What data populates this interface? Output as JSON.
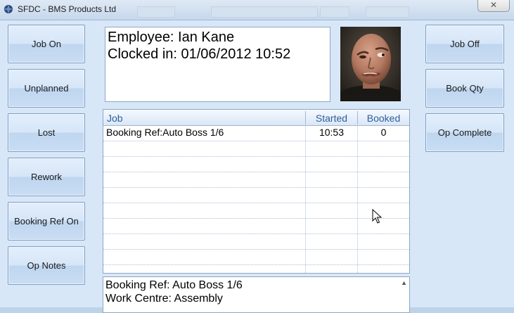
{
  "window": {
    "title": "SFDC - BMS Products Ltd",
    "close_label": "✕"
  },
  "left_buttons": [
    {
      "label": "Job On"
    },
    {
      "label": "Unplanned"
    },
    {
      "label": "Lost"
    },
    {
      "label": "Rework"
    },
    {
      "label": "Booking Ref On"
    },
    {
      "label": "Op Notes"
    }
  ],
  "right_buttons": [
    {
      "label": "Job Off"
    },
    {
      "label": "Book Qty"
    },
    {
      "label": "Op Complete"
    }
  ],
  "employee": {
    "name_line": "Employee: Ian Kane",
    "clock_line": "Clocked in: 01/06/2012 10:52"
  },
  "grid": {
    "columns": [
      "Job",
      "Started",
      "Booked"
    ],
    "rows": [
      {
        "job": "Booking Ref:Auto Boss 1/6",
        "started": "10:53",
        "booked": "0"
      }
    ]
  },
  "notes": {
    "lines": [
      "Booking Ref: Auto Boss 1/6",
      "Work Centre: Assembly"
    ]
  }
}
